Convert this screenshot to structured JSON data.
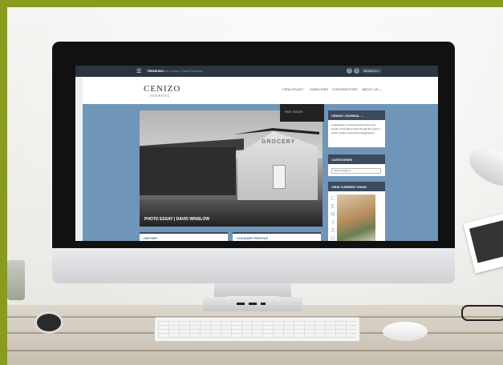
{
  "topbar": {
    "trending_label": "TRENDING",
    "trending_text": "Photo Essay | David Winslow",
    "facebook_icon": "f",
    "search_label": "SEARCH"
  },
  "header": {
    "logo": "CENIZO",
    "logo_sub": "JOURNAL"
  },
  "nav": {
    "items": [
      "VIEW ISSUES",
      "SUBSCRIBE",
      "CONTRIBUTORS",
      "ABOUT US"
    ]
  },
  "dropdown": {
    "item": "PAST ISSUES"
  },
  "hero": {
    "caption": "PHOTO ESSAY | DAVID WINSLOW",
    "sign_text": "GROCERY"
  },
  "sidebar": {
    "about_title": "CENIZO JOURNAL ...",
    "about_text": "is dedicated to chronicling the history and people of Far West Texas through the work of writers, artists, poets and photographers.",
    "categories_title": "CATEGORIES",
    "categories_select": "Select Category",
    "issue_title": "VIEW CURRENT ISSUE",
    "cover_letters": [
      "C",
      "E",
      "N",
      "I",
      "Z",
      "O"
    ]
  },
  "cards": {
    "left": "HISTORY",
    "right": "CULINARY PROFILE"
  },
  "colors": {
    "frame": "#8a9a1f",
    "site_blue": "#6f95b8",
    "sidebar_header": "#3b4a5c"
  }
}
